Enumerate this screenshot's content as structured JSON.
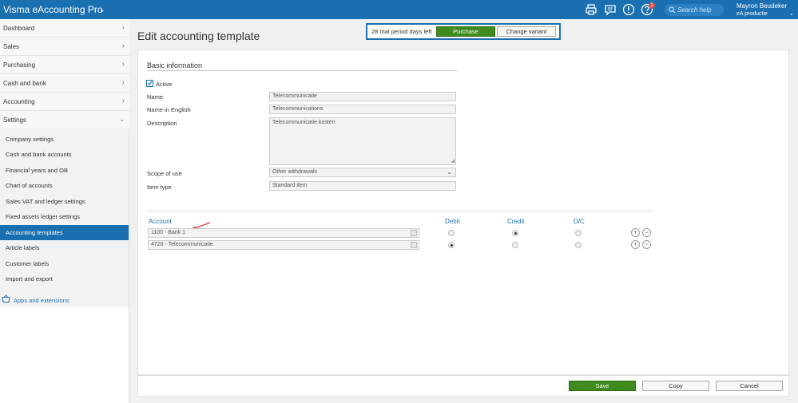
{
  "app": {
    "title": "Visma eAccounting Pro"
  },
  "header": {
    "search_placeholder": "Search help",
    "notification_count": "1",
    "user_name": "Mayron Beudeker",
    "user_org": "eA productie"
  },
  "sidebar": {
    "main_items": [
      {
        "label": "Dashboard"
      },
      {
        "label": "Sales"
      },
      {
        "label": "Purchasing"
      },
      {
        "label": "Cash and bank"
      },
      {
        "label": "Accounting"
      },
      {
        "label": "Settings"
      }
    ],
    "settings_items": [
      {
        "label": "Company settings"
      },
      {
        "label": "Cash and bank accounts"
      },
      {
        "label": "Financial years and OB"
      },
      {
        "label": "Chart of accounts"
      },
      {
        "label": "Sales VAT and ledger settings"
      },
      {
        "label": "Fixed assets ledger settings"
      },
      {
        "label": "Accounting templates"
      },
      {
        "label": "Article labels"
      },
      {
        "label": "Customer labels"
      },
      {
        "label": "Import and export"
      }
    ],
    "apps_label": "Apps and extensions"
  },
  "page": {
    "title": "Edit accounting template"
  },
  "trial": {
    "text": "28 trial period days left",
    "purchase_label": "Purchase",
    "variant_label": "Change variant"
  },
  "form": {
    "section_title": "Basic information",
    "active_label": "Active",
    "name_label": "Name",
    "name_value": "Telecommunicatie",
    "name_en_label": "Name in English",
    "name_en_value": "Telecommunications",
    "description_label": "Description",
    "description_value": "Telecommunicatie kosten",
    "scope_label": "Scope of use",
    "scope_value": "Other withdrawals",
    "item_type_label": "Item type",
    "item_type_value": "Standard item"
  },
  "table": {
    "headers": {
      "account": "Account",
      "debit": "Debit",
      "credit": "Credit",
      "dc": "D/C"
    },
    "rows": [
      {
        "account": "1100 - Bank 1"
      },
      {
        "account": "4720 - Telecommunicatie"
      }
    ]
  },
  "footer": {
    "save_label": "Save",
    "copy_label": "Copy",
    "cancel_label": "Cancel"
  },
  "colors": {
    "brand_blue": "#1a6fb0",
    "primary_green": "#3f8b1e"
  }
}
